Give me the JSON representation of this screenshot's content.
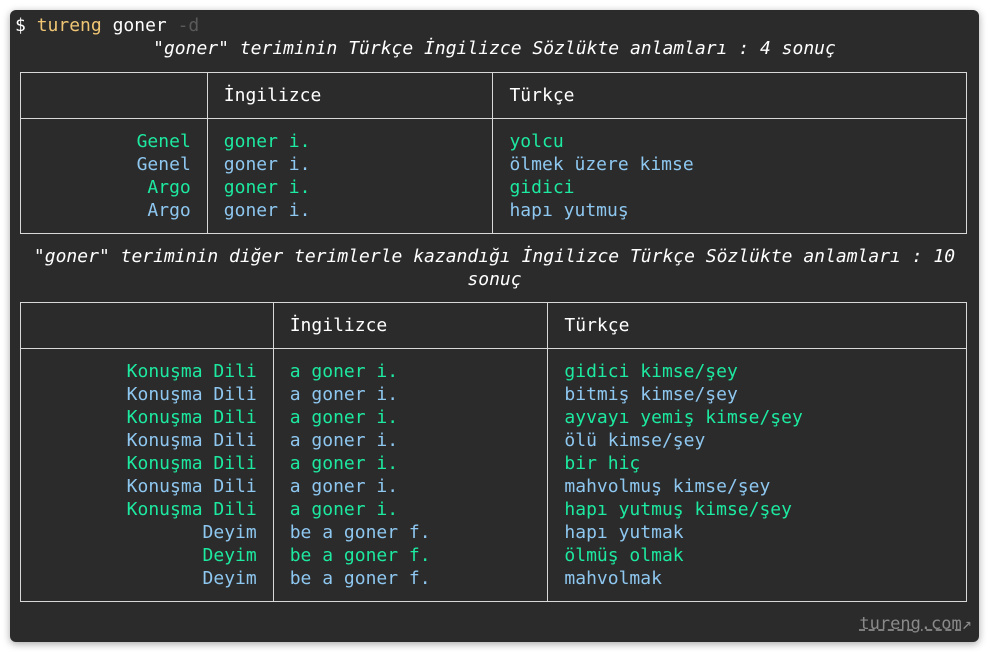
{
  "prompt": {
    "symbol": "$",
    "command": "tureng",
    "argument": "goner",
    "flag": "-d"
  },
  "section1": {
    "caption": "\"goner\" teriminin Türkçe İngilizce Sözlükte anlamları : 4 sonuç",
    "headers": [
      "",
      "İngilizce",
      "Türkçe"
    ],
    "rows": [
      {
        "category": "Genel",
        "english": "goner i.",
        "turkish": "yolcu",
        "color": "#1de9a0"
      },
      {
        "category": "Genel",
        "english": "goner i.",
        "turkish": "ölmek üzere kimse",
        "color": "#8ec7f0"
      },
      {
        "category": "Argo",
        "english": "goner i.",
        "turkish": "gidici",
        "color": "#1de9a0"
      },
      {
        "category": "Argo",
        "english": "goner i.",
        "turkish": "hapı yutmuş",
        "color": "#8ec7f0"
      }
    ]
  },
  "section2": {
    "caption": "\"goner\" teriminin diğer terimlerle kazandığı İngilizce Türkçe Sözlükte anlamları : 10 sonuç",
    "headers": [
      "",
      "İngilizce",
      "Türkçe"
    ],
    "rows": [
      {
        "category": "Konuşma Dili",
        "english": "a goner i.",
        "turkish": "gidici kimse/şey",
        "color": "#1de9a0"
      },
      {
        "category": "Konuşma Dili",
        "english": "a goner i.",
        "turkish": "bitmiş kimse/şey",
        "color": "#8ec7f0"
      },
      {
        "category": "Konuşma Dili",
        "english": "a goner i.",
        "turkish": "ayvayı yemiş kimse/şey",
        "color": "#1de9a0"
      },
      {
        "category": "Konuşma Dili",
        "english": "a goner i.",
        "turkish": "ölü kimse/şey",
        "color": "#8ec7f0"
      },
      {
        "category": "Konuşma Dili",
        "english": "a goner i.",
        "turkish": "bir hiç",
        "color": "#1de9a0"
      },
      {
        "category": "Konuşma Dili",
        "english": "a goner i.",
        "turkish": "mahvolmuş kimse/şey",
        "color": "#8ec7f0"
      },
      {
        "category": "Konuşma Dili",
        "english": "a goner i.",
        "turkish": "hapı yutmuş kimse/şey",
        "color": "#1de9a0"
      },
      {
        "category": "Deyim",
        "english": "be a goner f.",
        "turkish": "hapı yutmak",
        "color": "#8ec7f0"
      },
      {
        "category": "Deyim",
        "english": "be a goner f.",
        "turkish": "ölmüş olmak",
        "color": "#1de9a0"
      },
      {
        "category": "Deyim",
        "english": "be a goner f.",
        "turkish": "mahvolmak",
        "color": "#8ec7f0"
      }
    ]
  },
  "footer": {
    "link_text": "tureng.com",
    "link_icon": "external-link-icon"
  }
}
